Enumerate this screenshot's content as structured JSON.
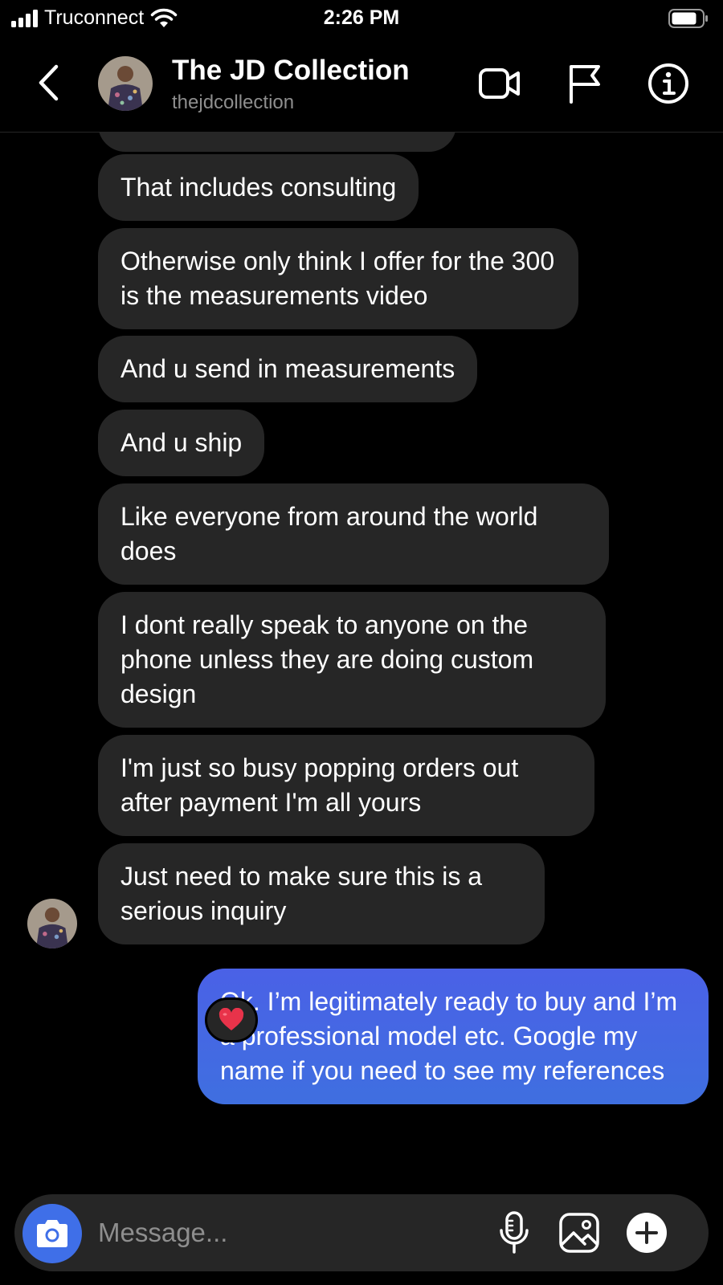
{
  "status_bar": {
    "carrier": "Truconnect",
    "time": "2:26 PM"
  },
  "header": {
    "name": "The JD Collection",
    "username": "thejdcollection",
    "icons": [
      "back-icon",
      "video-call-icon",
      "flag-icon",
      "info-icon"
    ]
  },
  "messages": [
    {
      "from": "them",
      "text": "That includes consulting"
    },
    {
      "from": "them",
      "text": "Otherwise only think I offer for the 300 is the measurements video"
    },
    {
      "from": "them",
      "text": "And u send in measurements"
    },
    {
      "from": "them",
      "text": "And u ship"
    },
    {
      "from": "them",
      "text": "Like everyone from around the world does"
    },
    {
      "from": "them",
      "text": "I dont really speak to anyone on the phone unless they are doing custom design"
    },
    {
      "from": "them",
      "text": "I'm just so busy popping orders out after payment I'm all yours"
    },
    {
      "from": "them",
      "text": "Just need to make sure this is a serious inquiry"
    },
    {
      "from": "me",
      "text": "Ok. I’m legitimately ready to buy and I’m a professional model etc. Google my name if you need to see my references",
      "reaction": "❤️"
    }
  ],
  "composer": {
    "placeholder": "Message...",
    "icons": [
      "camera-icon",
      "microphone-icon",
      "gallery-icon",
      "plus-icon"
    ]
  },
  "colors": {
    "background": "#000000",
    "incoming_bubble": "#262626",
    "outgoing_bubble": "#4a61e6",
    "accent": "#3f6fe8",
    "muted_text": "#8e8e8e"
  }
}
